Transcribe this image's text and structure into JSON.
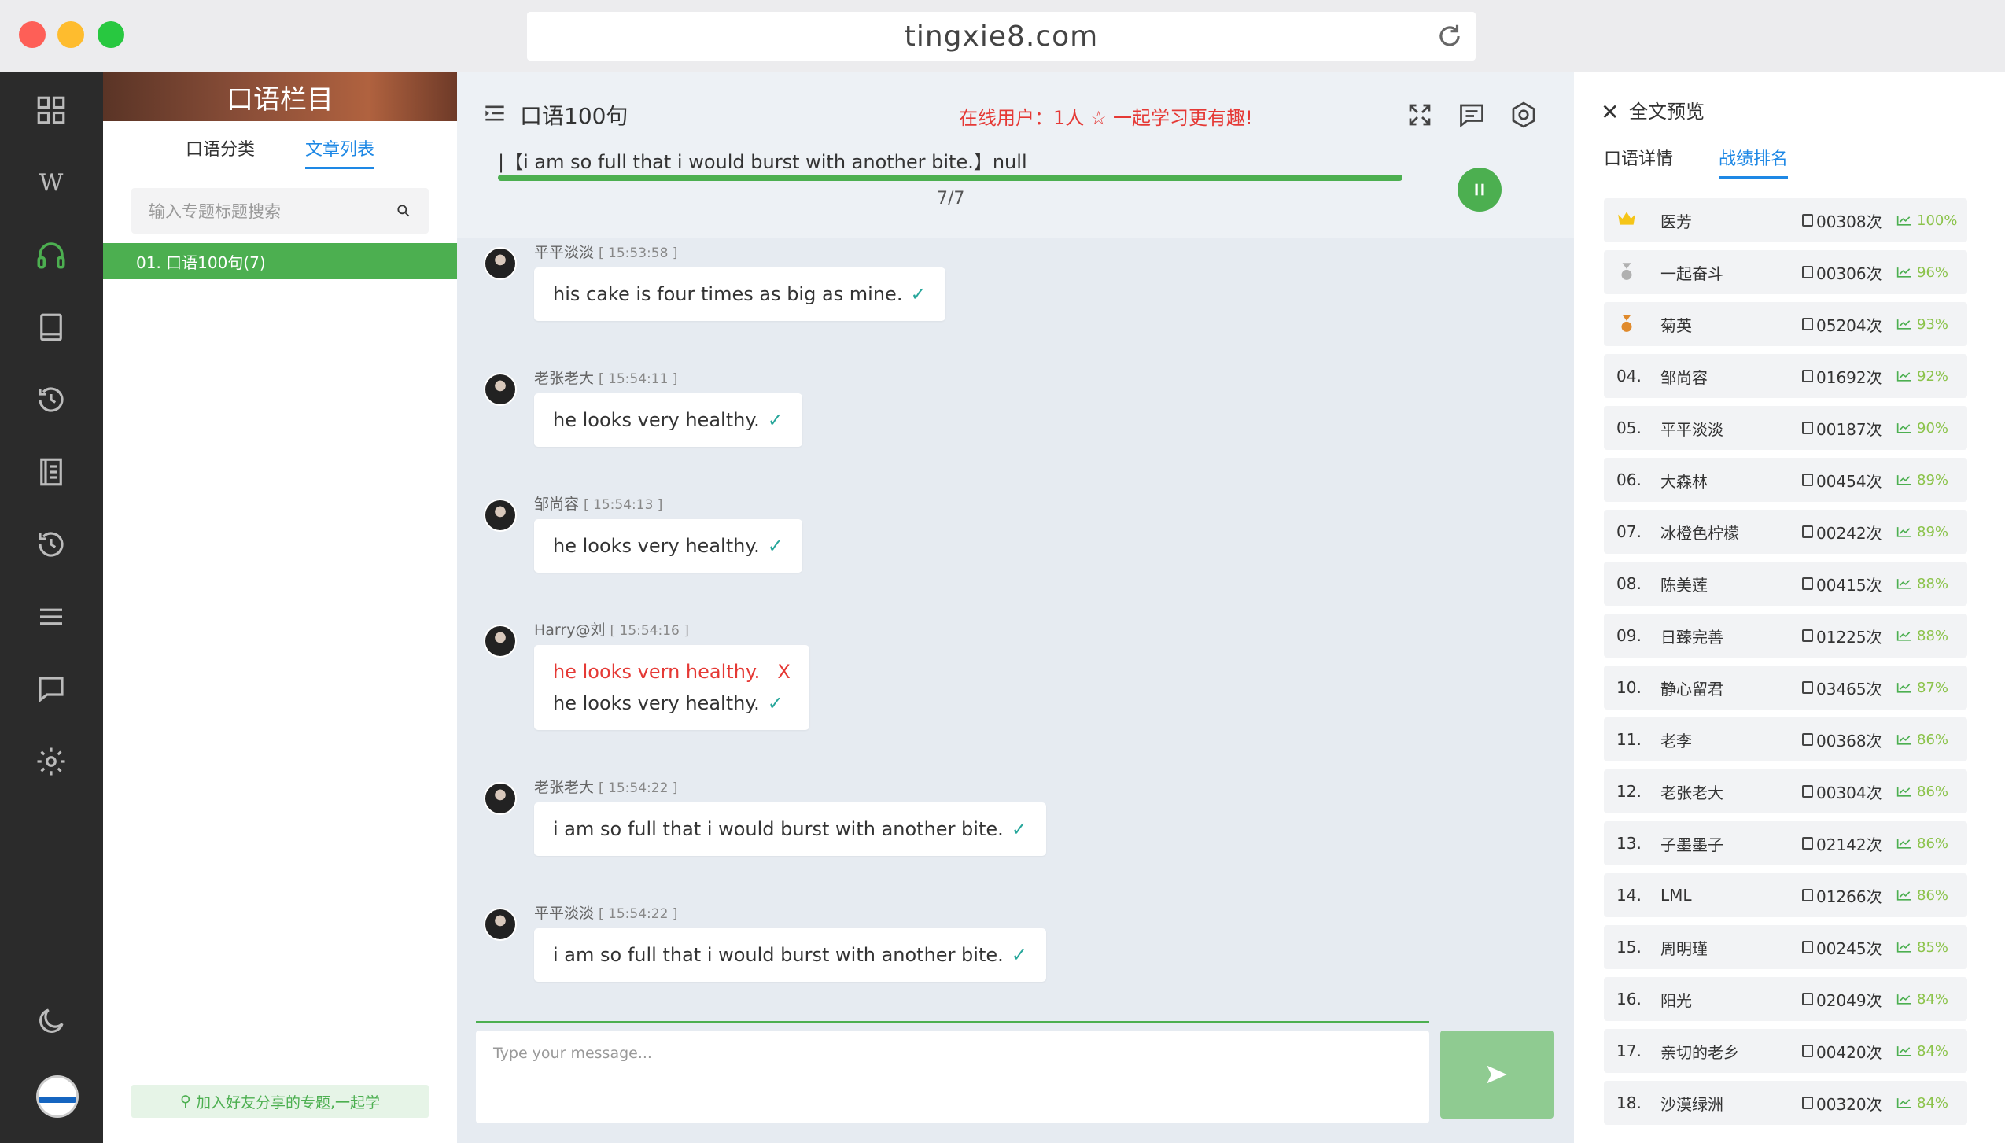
{
  "browser": {
    "url": "tingxie8.com"
  },
  "colpanel": {
    "header": "口语栏目",
    "tabs": [
      "口语分类",
      "文章列表"
    ],
    "search_placeholder": "输入专题标题搜索",
    "items": [
      "01. 口语100句(7)"
    ],
    "join_button": "加入好友分享的专题,一起学"
  },
  "chat": {
    "title": "口语100句",
    "online": "在线用户：1人 ☆ 一起学习更有趣!",
    "current_sentence": "|【i am so full that i would burst with another bite.】null",
    "progress": 1.0,
    "count": "7/7",
    "input_placeholder": "Type your message...",
    "messages": [
      {
        "user": "平平淡淡",
        "time": "[ 15:53:58 ]",
        "lines": [
          {
            "text": "his cake is four times as big as mine.",
            "mark": "✓",
            "ok": true
          }
        ]
      },
      {
        "user": "老张老大",
        "time": "[ 15:54:11 ]",
        "lines": [
          {
            "text": "he looks very healthy.",
            "mark": "✓",
            "ok": true
          }
        ]
      },
      {
        "user": "邹尚容",
        "time": "[ 15:54:13 ]",
        "lines": [
          {
            "text": "he looks very healthy.",
            "mark": "✓",
            "ok": true
          }
        ]
      },
      {
        "user": "Harry@刘",
        "time": "[ 15:54:16 ]",
        "lines": [
          {
            "text": "he looks vern healthy.",
            "mark": "X",
            "ok": false
          },
          {
            "text": "he looks very healthy.",
            "mark": "✓",
            "ok": true
          }
        ]
      },
      {
        "user": "老张老大",
        "time": "[ 15:54:22 ]",
        "lines": [
          {
            "text": "i am so full that i would burst with another bite.",
            "mark": "✓",
            "ok": true
          }
        ]
      },
      {
        "user": "平平淡淡",
        "time": "[ 15:54:22 ]",
        "lines": [
          {
            "text": "i am so full that i would burst with another bite.",
            "mark": "✓",
            "ok": true
          }
        ]
      }
    ]
  },
  "rpanel": {
    "close": "✕",
    "title": "全文预览",
    "tabs": [
      "口语详情",
      "战绩排名"
    ],
    "ranking": [
      {
        "no": "",
        "medal": "gold",
        "name": "医芳",
        "count": "00308次",
        "pct": "100%"
      },
      {
        "no": "",
        "medal": "silver",
        "name": "一起奋斗",
        "count": "00306次",
        "pct": "96%"
      },
      {
        "no": "",
        "medal": "bronze",
        "name": "菊英",
        "count": "05204次",
        "pct": "93%"
      },
      {
        "no": "04.",
        "name": "邹尚容",
        "count": "01692次",
        "pct": "92%"
      },
      {
        "no": "05.",
        "name": "平平淡淡",
        "count": "00187次",
        "pct": "90%"
      },
      {
        "no": "06.",
        "name": "大森林",
        "count": "00454次",
        "pct": "89%"
      },
      {
        "no": "07.",
        "name": "冰橙色柠檬",
        "count": "00242次",
        "pct": "89%"
      },
      {
        "no": "08.",
        "name": "陈美莲",
        "count": "00415次",
        "pct": "88%"
      },
      {
        "no": "09.",
        "name": "日臻完善",
        "count": "01225次",
        "pct": "88%"
      },
      {
        "no": "10.",
        "name": "静心留君",
        "count": "03465次",
        "pct": "87%"
      },
      {
        "no": "11.",
        "name": "老李",
        "count": "00368次",
        "pct": "86%"
      },
      {
        "no": "12.",
        "name": "老张老大",
        "count": "00304次",
        "pct": "86%"
      },
      {
        "no": "13.",
        "name": "子墨墨子",
        "count": "02142次",
        "pct": "86%"
      },
      {
        "no": "14.",
        "name": "LML",
        "count": "01266次",
        "pct": "86%"
      },
      {
        "no": "15.",
        "name": "周明瑾",
        "count": "00245次",
        "pct": "85%"
      },
      {
        "no": "16.",
        "name": "阳光",
        "count": "02049次",
        "pct": "84%"
      },
      {
        "no": "17.",
        "name": "亲切的老乡",
        "count": "00420次",
        "pct": "84%"
      },
      {
        "no": "18.",
        "name": "沙漠绿洲",
        "count": "00320次",
        "pct": "84%"
      }
    ]
  },
  "icons": {
    "sidebar": [
      "grid-icon",
      "wikipedia-icon",
      "headphones-icon",
      "book-icon",
      "history-icon",
      "notebook-icon",
      "history-icon",
      "list-icon",
      "chat-icon",
      "gear-icon",
      "moon-icon"
    ]
  },
  "colors": {
    "accent": "#4caf50",
    "link": "#1e88e5",
    "error": "#e53935",
    "ok": "#26a69a"
  }
}
